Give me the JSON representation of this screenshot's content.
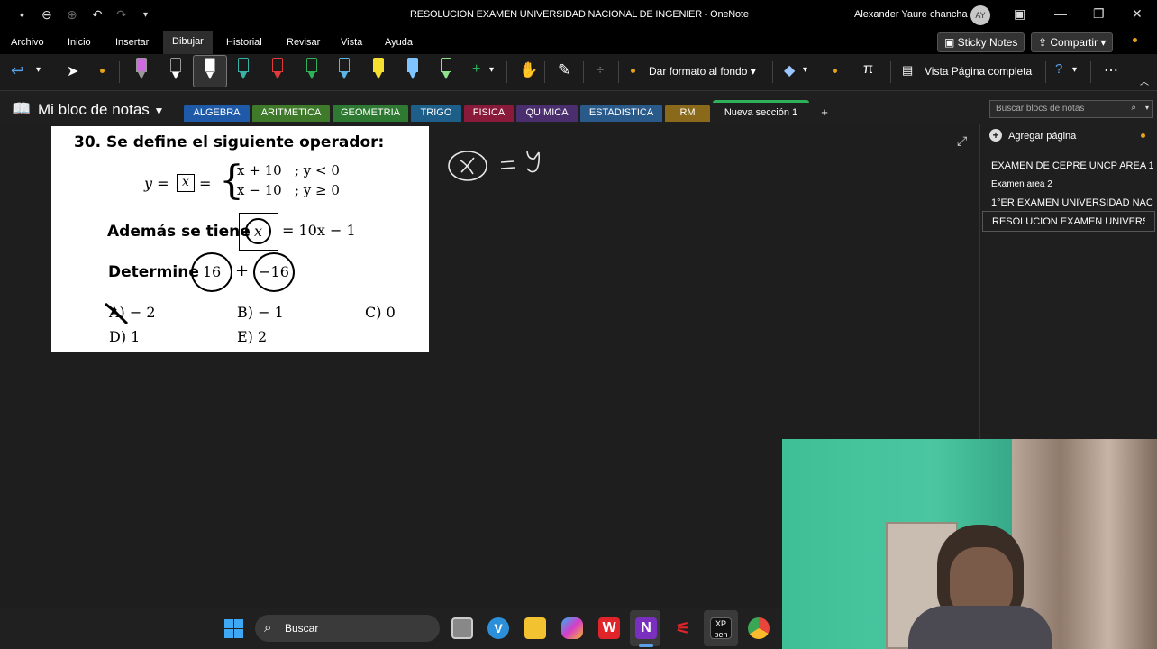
{
  "titlebar": {
    "doc_title": "RESOLUCION EXAMEN UNIVERSIDAD NACIONAL DE INGENIER  -  OneNote",
    "user_name": "Alexander Yaure chancha",
    "avatar_initials": "AY"
  },
  "menubar": {
    "items": [
      "Archivo",
      "Inicio",
      "Insertar",
      "Dibujar",
      "Historial",
      "Revisar",
      "Vista",
      "Ayuda"
    ],
    "sticky_notes": "Sticky Notes",
    "share": "Compartir"
  },
  "ribbon": {
    "format_background": "Dar formato al fondo",
    "full_page_view": "Vista Página completa",
    "pen_colors": [
      "#cf6ae0",
      "#ffffff",
      "#ffffff",
      "#37b3a7",
      "#e23a3a",
      "#2fb05a",
      "#5ab4e6",
      "#f5e030",
      "#7fc4ff",
      "#8ee28e"
    ]
  },
  "notebook": {
    "name": "Mi bloc de notas",
    "tabs": [
      {
        "label": "ALGEBRA",
        "color": "#1e5aa8"
      },
      {
        "label": "ARITMETICA",
        "color": "#3f7a2a"
      },
      {
        "label": "GEOMETRIA",
        "color": "#2f7a33"
      },
      {
        "label": "TRIGO",
        "color": "#1e5f8a"
      },
      {
        "label": "FISICA",
        "color": "#8a1a3a"
      },
      {
        "label": "QUIMICA",
        "color": "#4a2e6e"
      },
      {
        "label": "ESTADISTICA",
        "color": "#2a5a8a"
      },
      {
        "label": "RM",
        "color": "#8a6a1a"
      },
      {
        "label": "Nueva sección 1",
        "color": "#1f1f1f"
      }
    ],
    "add_tab": "+",
    "search_placeholder": "Buscar blocs de notas"
  },
  "problem": {
    "number": "30.",
    "statement": "Se define el siguiente operador:",
    "lhs": "y = ",
    "boxed_x": "x",
    "case1": "x + 10   ; y < 0",
    "case2": "x − 10   ; y ≥ 0",
    "also_label": "Además se tiene",
    "circled_x": "x",
    "also_rhs": "= 10x − 1",
    "determine_label": "Determine",
    "circle_a": "16",
    "plus": "+",
    "circle_b": "−16",
    "options": {
      "a": "A)  − 2",
      "b": "B)  − 1",
      "c": "C) 0",
      "d": "D) 1",
      "e": "E) 2"
    }
  },
  "handwriting": {
    "eq": "=",
    "var": "y"
  },
  "pages": {
    "add_page": "Agregar página",
    "items": [
      "EXAMEN DE CEPRE UNCP AREA 1",
      "Examen area 2",
      "1°ER EXAMEN UNIVERSIDAD NAC",
      "RESOLUCION EXAMEN UNIVERSI"
    ],
    "selected_index": 3
  },
  "taskbar": {
    "search_label": "Buscar"
  }
}
